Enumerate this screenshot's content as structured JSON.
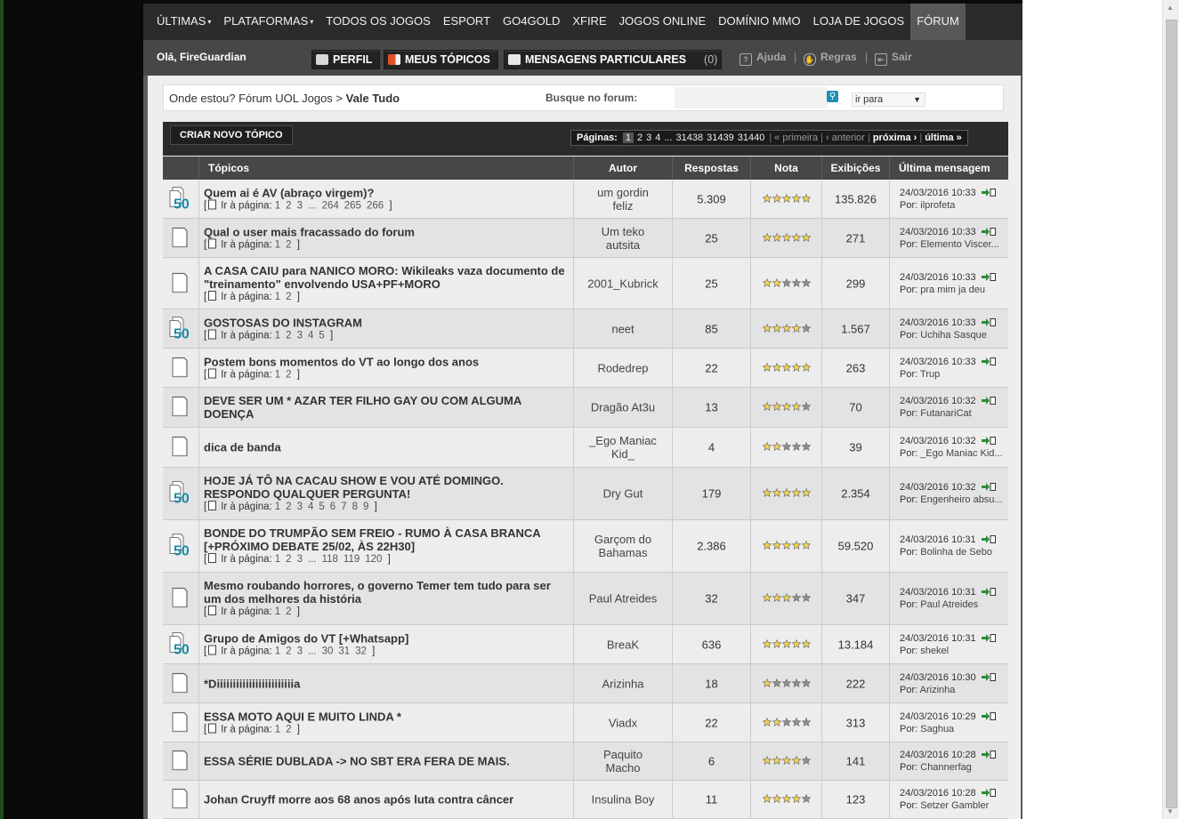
{
  "nav": {
    "items": [
      {
        "label": "ÚLTIMAS",
        "caret": true
      },
      {
        "label": "PLATAFORMAS",
        "caret": true
      },
      {
        "label": "TODOS OS JOGOS",
        "caret": false
      },
      {
        "label": "ESPORT",
        "caret": false
      },
      {
        "label": "GO4GOLD",
        "caret": false
      },
      {
        "label": "XFIRE",
        "caret": false
      },
      {
        "label": "JOGOS ONLINE",
        "caret": false
      },
      {
        "label": "DOMÍNIO MMO",
        "caret": false
      },
      {
        "label": "LOJA DE JOGOS",
        "caret": false
      },
      {
        "label": "FÓRUM",
        "caret": false,
        "active": true
      }
    ]
  },
  "userbar": {
    "greeting": "Olá, FireGuardian",
    "profile_label": "PERFIL",
    "my_topics_label": "MEUS TÓPICOS",
    "messages_label": "MENSAGENS PARTICULARES",
    "messages_count": "(0)",
    "help_label": "Ajuda",
    "rules_label": "Regras",
    "logout_label": "Sair"
  },
  "breadcrumb": {
    "prefix": "Onde estou?",
    "forum": "Fórum UOL Jogos",
    "separator": ">",
    "current": "Vale Tudo"
  },
  "search": {
    "label": "Busque no forum:",
    "placeholder": "",
    "jump_label": "ir para"
  },
  "actions": {
    "new_topic_label": "CRIAR NOVO TÓPICO"
  },
  "pager": {
    "label": "Páginas:",
    "current": "1",
    "pages": [
      "2",
      "3",
      "4"
    ],
    "ellipsis": "...",
    "last_pages": [
      "31438",
      "31439",
      "31440"
    ],
    "first_label": "« primeira",
    "prev_label": "‹ anterior",
    "next_label": "próxima ›",
    "last_label": "última »"
  },
  "table": {
    "headers": {
      "topics": "Tópicos",
      "author": "Autor",
      "replies": "Respostas",
      "rating": "Nota",
      "views": "Exibições",
      "last": "Última mensagem"
    },
    "goto_label": "Ir à página:",
    "by_label": "Por:",
    "rows": [
      {
        "hot": true,
        "title": "Quem ai é AV (abraço virgem)?",
        "pages": [
          "1",
          "2",
          "3",
          "...",
          "264",
          "265",
          "266"
        ],
        "author": "um gordin feliz",
        "replies": "5.309",
        "rating": 5,
        "views": "135.826",
        "last_date": "24/03/2016 10:33",
        "last_by": "ilprofeta"
      },
      {
        "hot": false,
        "title": "Qual o user mais fracassado do forum",
        "pages": [
          "1",
          "2"
        ],
        "author": "Um teko autsita",
        "replies": "25",
        "rating": 5,
        "views": "271",
        "last_date": "24/03/2016 10:33",
        "last_by": "Elemento Viscer..."
      },
      {
        "hot": false,
        "title": "A CASA CAIU para NANICO MORO: Wikileaks vaza documento de \"treinamento\" envolvendo USA+PF+MORO",
        "pages": [
          "1",
          "2"
        ],
        "author": "2001_Kubrick",
        "replies": "25",
        "rating": 2,
        "views": "299",
        "last_date": "24/03/2016 10:33",
        "last_by": "pra mim ja deu"
      },
      {
        "hot": true,
        "title": "GOSTOSAS DO INSTAGRAM",
        "pages": [
          "1",
          "2",
          "3",
          "4",
          "5"
        ],
        "author": "neet",
        "replies": "85",
        "rating": 4,
        "views": "1.567",
        "last_date": "24/03/2016 10:33",
        "last_by": "Uchiha Sasque"
      },
      {
        "hot": false,
        "title": "Postem bons momentos do VT ao longo dos anos",
        "pages": [
          "1",
          "2"
        ],
        "author": "Rodedrep",
        "replies": "22",
        "rating": 5,
        "views": "263",
        "last_date": "24/03/2016 10:33",
        "last_by": "Trup"
      },
      {
        "hot": false,
        "title": "DEVE SER UM * AZAR TER FILHO GAY OU COM ALGUMA DOENÇA",
        "pages": [],
        "author": "Dragão At3u",
        "replies": "13",
        "rating": 4,
        "views": "70",
        "last_date": "24/03/2016 10:32",
        "last_by": "FutanariCat"
      },
      {
        "hot": false,
        "title": "dica de banda",
        "pages": [],
        "author": "_Ego Maniac Kid_",
        "replies": "4",
        "rating": 2,
        "views": "39",
        "last_date": "24/03/2016 10:32",
        "last_by": "_Ego Maniac Kid..."
      },
      {
        "hot": true,
        "title": "HOJE JÁ TÔ NA CACAU SHOW E VOU ATÉ DOMINGO. RESPONDO QUALQUER PERGUNTA!",
        "pages": [
          "1",
          "2",
          "3",
          "4",
          "5",
          "6",
          "7",
          "8",
          "9"
        ],
        "author": "Dry Gut",
        "replies": "179",
        "rating": 5,
        "views": "2.354",
        "last_date": "24/03/2016 10:32",
        "last_by": "Engenheiro absu..."
      },
      {
        "hot": true,
        "title": "BONDE DO TRUMPÃO SEM FREIO - RUMO À CASA BRANCA [+PRÓXIMO DEBATE 25/02, ÀS 22H30]",
        "pages": [
          "1",
          "2",
          "3",
          "...",
          "118",
          "119",
          "120"
        ],
        "author": "Garçom do Bahamas",
        "replies": "2.386",
        "rating": 5,
        "views": "59.520",
        "last_date": "24/03/2016 10:31",
        "last_by": "Bolinha de Sebo"
      },
      {
        "hot": false,
        "title": "Mesmo roubando horrores, o governo Temer tem tudo para ser um dos melhores da história",
        "pages": [
          "1",
          "2"
        ],
        "author": "Paul Atreides",
        "replies": "32",
        "rating": 3,
        "views": "347",
        "last_date": "24/03/2016 10:31",
        "last_by": "Paul Atreides"
      },
      {
        "hot": true,
        "title": "Grupo de Amigos do VT [+Whatsapp]",
        "pages": [
          "1",
          "2",
          "3",
          "...",
          "30",
          "31",
          "32"
        ],
        "author": "BreaK",
        "replies": "636",
        "rating": 5,
        "views": "13.184",
        "last_date": "24/03/2016 10:31",
        "last_by": "shekel"
      },
      {
        "hot": false,
        "title": "*Diiiiiiiiiiiiiiiiiiiiiiiia",
        "pages": [],
        "author": "Arizinha",
        "replies": "18",
        "rating": 1,
        "views": "222",
        "last_date": "24/03/2016 10:30",
        "last_by": "Arizinha"
      },
      {
        "hot": false,
        "title": "ESSA MOTO AQUI E MUITO LINDA *",
        "pages": [
          "1",
          "2"
        ],
        "author": "Viadx",
        "replies": "22",
        "rating": 2,
        "views": "313",
        "last_date": "24/03/2016 10:29",
        "last_by": "Saghua"
      },
      {
        "hot": false,
        "title": "ESSA SÉRIE DUBLADA -> NO SBT ERA FERA DE MAIS.",
        "pages": [],
        "author": "Paquito Macho",
        "replies": "6",
        "rating": 4,
        "views": "141",
        "last_date": "24/03/2016 10:28",
        "last_by": "Channerfag"
      },
      {
        "hot": false,
        "title": "Johan Cruyff morre aos 68 anos após luta contra câncer",
        "pages": [],
        "author": "Insulina Boy",
        "replies": "11",
        "rating": 4,
        "views": "123",
        "last_date": "24/03/2016 10:28",
        "last_by": "Setzer Gambler"
      }
    ]
  },
  "colors": {
    "star_on": "#f3d24a",
    "star_off": "#8f8f8f",
    "hot_icon": "#1a8aa8",
    "go_icon": "#2e8b3a"
  }
}
